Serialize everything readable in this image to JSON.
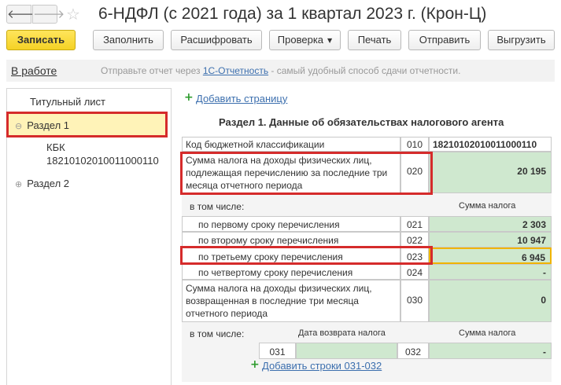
{
  "window": {
    "title": "6-НДФЛ (с 2021 года) за 1 квартал 2023 г. (Крон-Ц)",
    "back_icon": "arrow-left-icon",
    "forward_icon": "arrow-right-icon",
    "favorite_icon": "star-icon"
  },
  "toolbar": {
    "save": "Записать",
    "fill": "Заполнить",
    "decode": "Расшифровать",
    "check": "Проверка",
    "print": "Печать",
    "send": "Отправить",
    "export": "Выгрузить"
  },
  "infobar": {
    "status": "В работе",
    "text_before": "Отправьте отчет через ",
    "link": "1С-Отчетность",
    "text_after": " - самый удобный способ сдачи отчетности."
  },
  "sidebar": {
    "items": [
      {
        "label": "Титульный лист"
      },
      {
        "label": "Раздел 1",
        "toggle": "⊖"
      },
      {
        "label": "КБК",
        "sub": "18210102010011000110"
      },
      {
        "label": "Раздел 2",
        "toggle": "⊕"
      }
    ]
  },
  "content": {
    "add_page": "Добавить страницу",
    "section_title": "Раздел 1. Данные об обязательствах налогового агента",
    "rows": {
      "kbk": {
        "label": "Код бюджетной классификации",
        "code": "010",
        "value": "18210102010011000110"
      },
      "tax_total": {
        "label": "Сумма налога на доходы физических лиц, подлежащая перечислению за последние три месяца отчетного периода",
        "code": "020",
        "value": "20 195"
      },
      "including": "в том числе:",
      "tax_sum_header": "Сумма налога",
      "first_term": {
        "label": "по первому сроку перечисления",
        "code": "021",
        "value": "2 303"
      },
      "second_term": {
        "label": "по второму сроку перечисления",
        "code": "022",
        "value": "10 947"
      },
      "third_term": {
        "label": "по третьему сроку перечисления",
        "code": "023",
        "value": "6 945"
      },
      "fourth_term": {
        "label": "по четвертому сроку перечисления",
        "code": "024",
        "value": "-"
      },
      "returned": {
        "label": "Сумма налога на доходы физических лиц, возвращенная в последние три месяца отчетного периода",
        "code": "030",
        "value": "0"
      },
      "including2": "в том числе:",
      "return_date_header": "Дата возврата налога",
      "tax_sum_header2": "Сумма налога",
      "code_031": "031",
      "code_032": "032",
      "value_032": "-"
    },
    "add_rows": "Добавить строки 031-032"
  },
  "colors": {
    "highlight": "#d52b2b",
    "primary_button": "#f5d225",
    "input_green": "#cfe8cf",
    "active_row": "#fff3b8",
    "link": "#3c6fae"
  }
}
